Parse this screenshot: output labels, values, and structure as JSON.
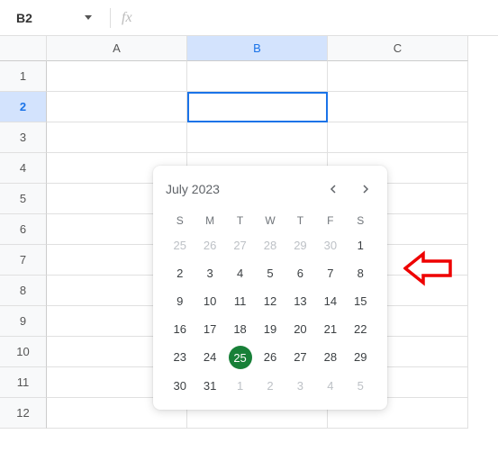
{
  "toolbar": {
    "cell_ref": "B2",
    "fx_label": "fx"
  },
  "columns": [
    "A",
    "B",
    "C"
  ],
  "active_column_index": 1,
  "rows": [
    "1",
    "2",
    "3",
    "4",
    "5",
    "6",
    "7",
    "8",
    "9",
    "10",
    "11",
    "12"
  ],
  "active_row_index": 1,
  "selected_cell": "B2",
  "datepicker": {
    "title": "July 2023",
    "dow": [
      "S",
      "M",
      "T",
      "W",
      "T",
      "F",
      "S"
    ],
    "days": [
      {
        "n": "25",
        "muted": true
      },
      {
        "n": "26",
        "muted": true
      },
      {
        "n": "27",
        "muted": true
      },
      {
        "n": "28",
        "muted": true
      },
      {
        "n": "29",
        "muted": true
      },
      {
        "n": "30",
        "muted": true
      },
      {
        "n": "1"
      },
      {
        "n": "2"
      },
      {
        "n": "3"
      },
      {
        "n": "4"
      },
      {
        "n": "5"
      },
      {
        "n": "6"
      },
      {
        "n": "7"
      },
      {
        "n": "8"
      },
      {
        "n": "9"
      },
      {
        "n": "10"
      },
      {
        "n": "11"
      },
      {
        "n": "12"
      },
      {
        "n": "13"
      },
      {
        "n": "14"
      },
      {
        "n": "15"
      },
      {
        "n": "16"
      },
      {
        "n": "17"
      },
      {
        "n": "18"
      },
      {
        "n": "19"
      },
      {
        "n": "20"
      },
      {
        "n": "21"
      },
      {
        "n": "22"
      },
      {
        "n": "23"
      },
      {
        "n": "24"
      },
      {
        "n": "25",
        "today": true
      },
      {
        "n": "26"
      },
      {
        "n": "27"
      },
      {
        "n": "28"
      },
      {
        "n": "29"
      },
      {
        "n": "30"
      },
      {
        "n": "31"
      },
      {
        "n": "1",
        "muted": true
      },
      {
        "n": "2",
        "muted": true
      },
      {
        "n": "3",
        "muted": true
      },
      {
        "n": "4",
        "muted": true
      },
      {
        "n": "5",
        "muted": true
      }
    ]
  }
}
